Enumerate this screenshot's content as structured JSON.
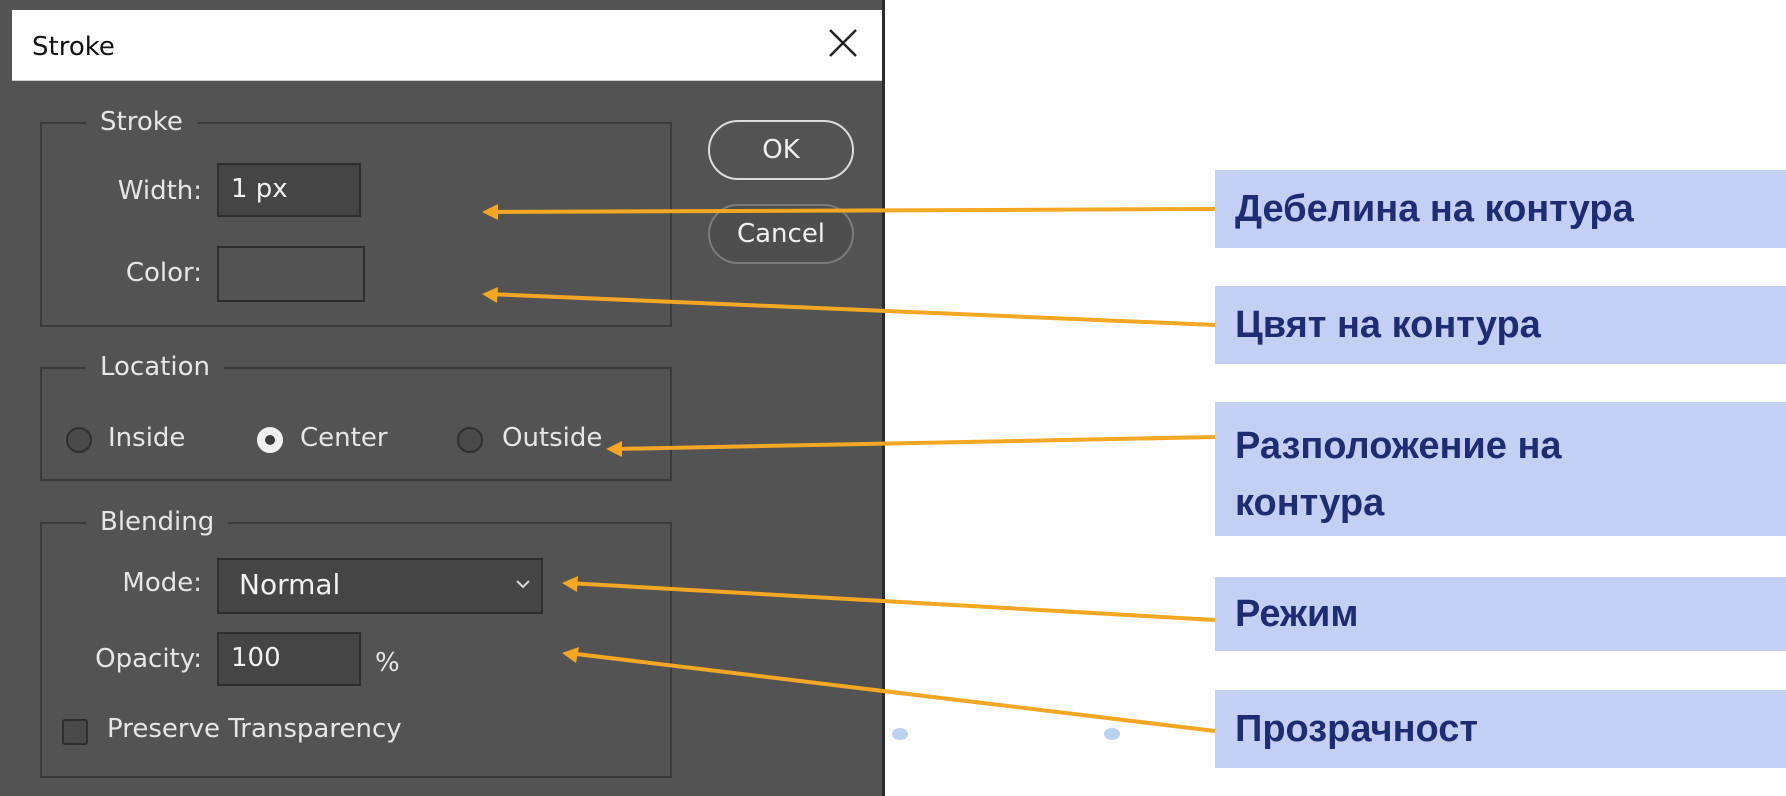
{
  "dialog": {
    "title": "Stroke",
    "stroke_group": {
      "title": "Stroke",
      "width_label": "Width:",
      "width_value": "1 px",
      "color_label": "Color:"
    },
    "location_group": {
      "title": "Location",
      "options": [
        "Inside",
        "Center",
        "Outside"
      ],
      "selected": "Center"
    },
    "blending_group": {
      "title": "Blending",
      "mode_label": "Mode:",
      "mode_value": "Normal",
      "opacity_label": "Opacity:",
      "opacity_value": "100",
      "opacity_unit": "%",
      "preserve_label": "Preserve Transparency",
      "preserve_checked": false
    },
    "buttons": {
      "ok": "OK",
      "cancel": "Cancel"
    }
  },
  "annotations": [
    "Дебелина на контура",
    "Цвят на контура",
    "Разположение на контура",
    "Режим",
    "Прозрачност"
  ],
  "colors": {
    "dialog_bg": "#535353",
    "callout_bg": "#c3d0f3",
    "callout_text": "#1d2c73",
    "arrow": "#f5a623"
  }
}
